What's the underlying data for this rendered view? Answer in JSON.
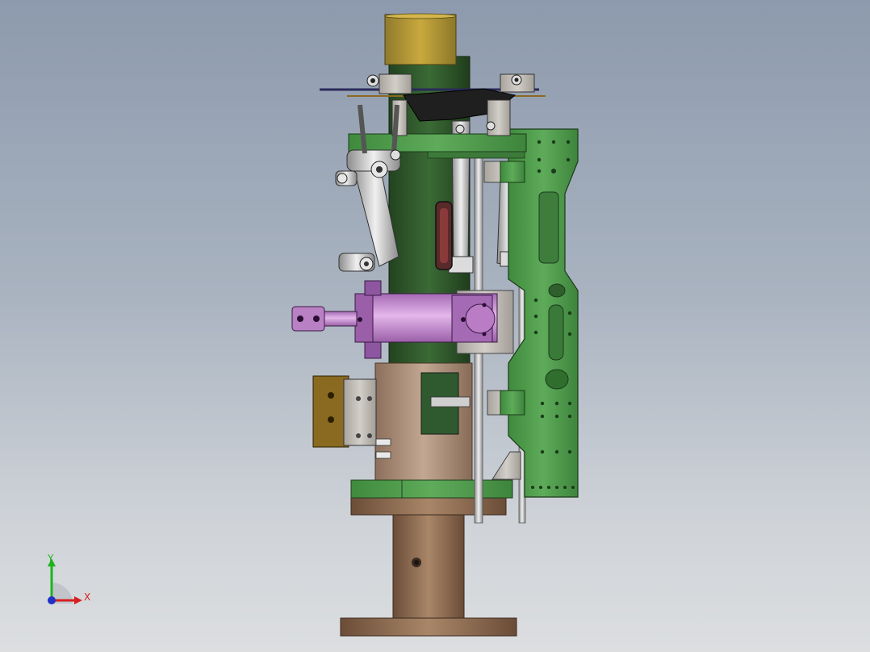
{
  "viewport": {
    "background_top": "#8d9aad",
    "background_bottom": "#dcdee0"
  },
  "colors": {
    "frame_green": "#4e9a4c",
    "column_green": "#2f5a2f",
    "brass_cap": "#b89a3a",
    "base_brown": "#8a6a52",
    "cylinder_purple": "#c58ad0",
    "plate_gray": "#c7c3bd",
    "guide_white": "#e4e4e4"
  },
  "triad": {
    "x_label": "X",
    "y_label": "Y",
    "x_color": "#d62020",
    "y_color": "#1fb31f",
    "z_color": "#2030c8"
  }
}
